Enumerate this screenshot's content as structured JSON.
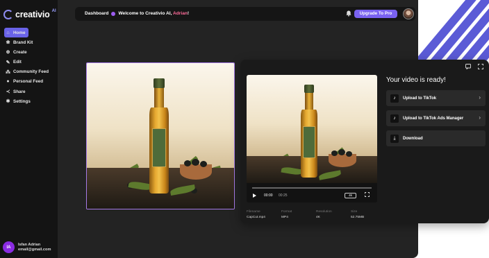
{
  "brand": {
    "name": "creativio",
    "sup": "AI"
  },
  "sidebar": {
    "items": [
      {
        "label": "Home",
        "icon": "home-icon",
        "active": true
      },
      {
        "label": "Brand Kit",
        "icon": "brand-kit-icon"
      },
      {
        "label": "Create",
        "icon": "create-icon"
      },
      {
        "label": "Edit",
        "icon": "edit-icon"
      },
      {
        "label": "Community Feed",
        "icon": "community-icon"
      },
      {
        "label": "Personal Feed",
        "icon": "person-icon"
      },
      {
        "label": "Share",
        "icon": "share-icon"
      },
      {
        "label": "Settings",
        "icon": "settings-icon"
      }
    ],
    "user": {
      "initials": "IA",
      "name": "Isfan Adrian",
      "email": "email@gmail.com"
    }
  },
  "topbar": {
    "crumb": "Dashboard",
    "welcome_prefix": "Welcome to Creativio AI, ",
    "welcome_name": "Adrian",
    "welcome_suffix": "!",
    "upgrade_label": "Upgrade To Pro"
  },
  "video": {
    "time_current": "00:00",
    "time_total": "00:25",
    "quality_badge": "4k",
    "meta": [
      {
        "key": "Filename",
        "value": "CapCut.mp4"
      },
      {
        "key": "Format",
        "value": "MP4"
      },
      {
        "key": "Resolution",
        "value": "4K"
      },
      {
        "key": "Size",
        "value": "52.75MB"
      }
    ]
  },
  "panel": {
    "title": "Your video is ready!",
    "actions": [
      {
        "label": "Upload to TikTok",
        "icon": "tiktok-icon",
        "chevron": true
      },
      {
        "label": "Upload to TikTok Ads Manager",
        "icon": "tiktok-ads-icon",
        "chevron": true
      },
      {
        "label": "Download",
        "icon": "download-icon",
        "chevron": false
      }
    ]
  },
  "colors": {
    "accent": "#6a63e8",
    "upgrade": "#7a62f0",
    "name_highlight": "#ff6b9a",
    "image_border": "#a67be8"
  }
}
